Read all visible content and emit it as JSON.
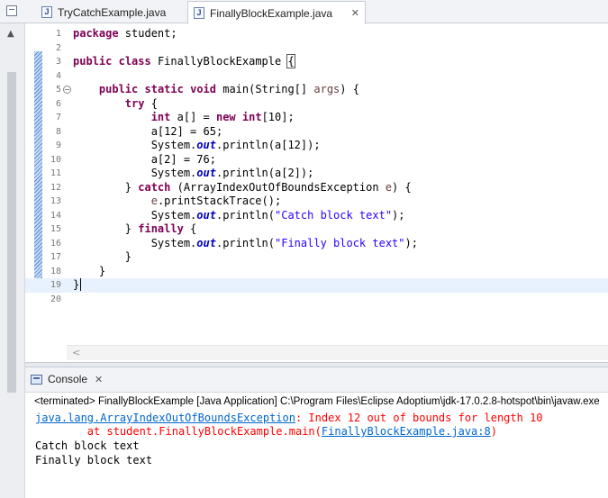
{
  "tabs": [
    {
      "label": "TryCatchExample.java",
      "active": false
    },
    {
      "label": "FinallyBlockExample.java",
      "active": true,
      "close": "✕"
    }
  ],
  "icons": {
    "java_file": "java-file-icon",
    "console": "console-icon",
    "minimize": "minimize-icon",
    "close": "close-icon"
  },
  "editor": {
    "current_line": 19,
    "lines": [
      {
        "n": "1",
        "tokens": [
          {
            "t": "kw",
            "v": "package"
          },
          {
            "t": "",
            "v": " student;"
          }
        ]
      },
      {
        "n": "2",
        "tokens": []
      },
      {
        "n": "3",
        "tokens": [
          {
            "t": "kw",
            "v": "public"
          },
          {
            "t": "",
            "v": " "
          },
          {
            "t": "kw",
            "v": "class"
          },
          {
            "t": "",
            "v": " FinallyBlockExample "
          },
          {
            "t": "bx",
            "v": "{"
          }
        ]
      },
      {
        "n": "4",
        "tokens": []
      },
      {
        "n": "5",
        "fold": true,
        "tokens": [
          {
            "t": "",
            "v": "    "
          },
          {
            "t": "kw",
            "v": "public"
          },
          {
            "t": "",
            "v": " "
          },
          {
            "t": "kw",
            "v": "static"
          },
          {
            "t": "",
            "v": " "
          },
          {
            "t": "kw",
            "v": "void"
          },
          {
            "t": "",
            "v": " main(String[] "
          },
          {
            "t": "pm",
            "v": "args"
          },
          {
            "t": "",
            "v": ") {"
          }
        ]
      },
      {
        "n": "6",
        "tokens": [
          {
            "t": "",
            "v": "        "
          },
          {
            "t": "kw",
            "v": "try"
          },
          {
            "t": "",
            "v": " {"
          }
        ]
      },
      {
        "n": "7",
        "tokens": [
          {
            "t": "",
            "v": "            "
          },
          {
            "t": "kw",
            "v": "int"
          },
          {
            "t": "",
            "v": " a[] = "
          },
          {
            "t": "kw",
            "v": "new"
          },
          {
            "t": "",
            "v": " "
          },
          {
            "t": "kw",
            "v": "int"
          },
          {
            "t": "",
            "v": "[10];"
          }
        ]
      },
      {
        "n": "8",
        "tokens": [
          {
            "t": "",
            "v": "            a[12] = 65;"
          }
        ]
      },
      {
        "n": "9",
        "tokens": [
          {
            "t": "",
            "v": "            System."
          },
          {
            "t": "it",
            "v": "out"
          },
          {
            "t": "",
            "v": ".println(a[12]);"
          }
        ]
      },
      {
        "n": "10",
        "tokens": [
          {
            "t": "",
            "v": "            a[2] = 76;"
          }
        ]
      },
      {
        "n": "11",
        "tokens": [
          {
            "t": "",
            "v": "            System."
          },
          {
            "t": "it",
            "v": "out"
          },
          {
            "t": "",
            "v": ".println(a[2]);"
          }
        ]
      },
      {
        "n": "12",
        "tokens": [
          {
            "t": "",
            "v": "        } "
          },
          {
            "t": "kw",
            "v": "catch"
          },
          {
            "t": "",
            "v": " (ArrayIndexOutOfBoundsException "
          },
          {
            "t": "pm",
            "v": "e"
          },
          {
            "t": "",
            "v": ") {"
          }
        ]
      },
      {
        "n": "13",
        "tokens": [
          {
            "t": "",
            "v": "            "
          },
          {
            "t": "pm",
            "v": "e"
          },
          {
            "t": "",
            "v": ".printStackTrace();"
          }
        ]
      },
      {
        "n": "14",
        "tokens": [
          {
            "t": "",
            "v": "            System."
          },
          {
            "t": "it",
            "v": "out"
          },
          {
            "t": "",
            "v": ".println("
          },
          {
            "t": "st",
            "v": "\"Catch block text\""
          },
          {
            "t": "",
            "v": ");"
          }
        ]
      },
      {
        "n": "15",
        "tokens": [
          {
            "t": "",
            "v": "        } "
          },
          {
            "t": "kw",
            "v": "finally"
          },
          {
            "t": "",
            "v": " {"
          }
        ]
      },
      {
        "n": "16",
        "tokens": [
          {
            "t": "",
            "v": "            System."
          },
          {
            "t": "it",
            "v": "out"
          },
          {
            "t": "",
            "v": ".println("
          },
          {
            "t": "st",
            "v": "\"Finally block text\""
          },
          {
            "t": "",
            "v": ");"
          }
        ]
      },
      {
        "n": "17",
        "tokens": [
          {
            "t": "",
            "v": "        }"
          }
        ]
      },
      {
        "n": "18",
        "tokens": [
          {
            "t": "",
            "v": "    }"
          }
        ]
      },
      {
        "n": "19",
        "tokens": [
          {
            "t": "",
            "v": "}"
          },
          {
            "t": "caret",
            "v": ""
          }
        ]
      },
      {
        "n": "20",
        "tokens": []
      }
    ],
    "hscroll_arrow": "<"
  },
  "console": {
    "title": "Console",
    "close": "✕",
    "terminated": "<terminated> FinallyBlockExample [Java Application] C:\\Program Files\\Eclipse Adoptium\\jdk-17.0.2.8-hotspot\\bin\\javaw.exe",
    "exception_link": "java.lang.ArrayIndexOutOfBoundsException",
    "exception_message": ": Index 12 out of bounds for length 10",
    "stack_prefix": "        at student.FinallyBlockExample.main(",
    "stack_link": "FinallyBlockExample.java:8",
    "stack_suffix": ")",
    "output": [
      "Catch block text",
      "Finally block text"
    ]
  },
  "colors": {
    "keyword": "#7f0055",
    "string": "#2a00ff",
    "field": "#0000c0",
    "param": "#6a3e3e",
    "error": "#ff0000",
    "link": "#0066cc",
    "current_line": "#e8f2fe"
  }
}
